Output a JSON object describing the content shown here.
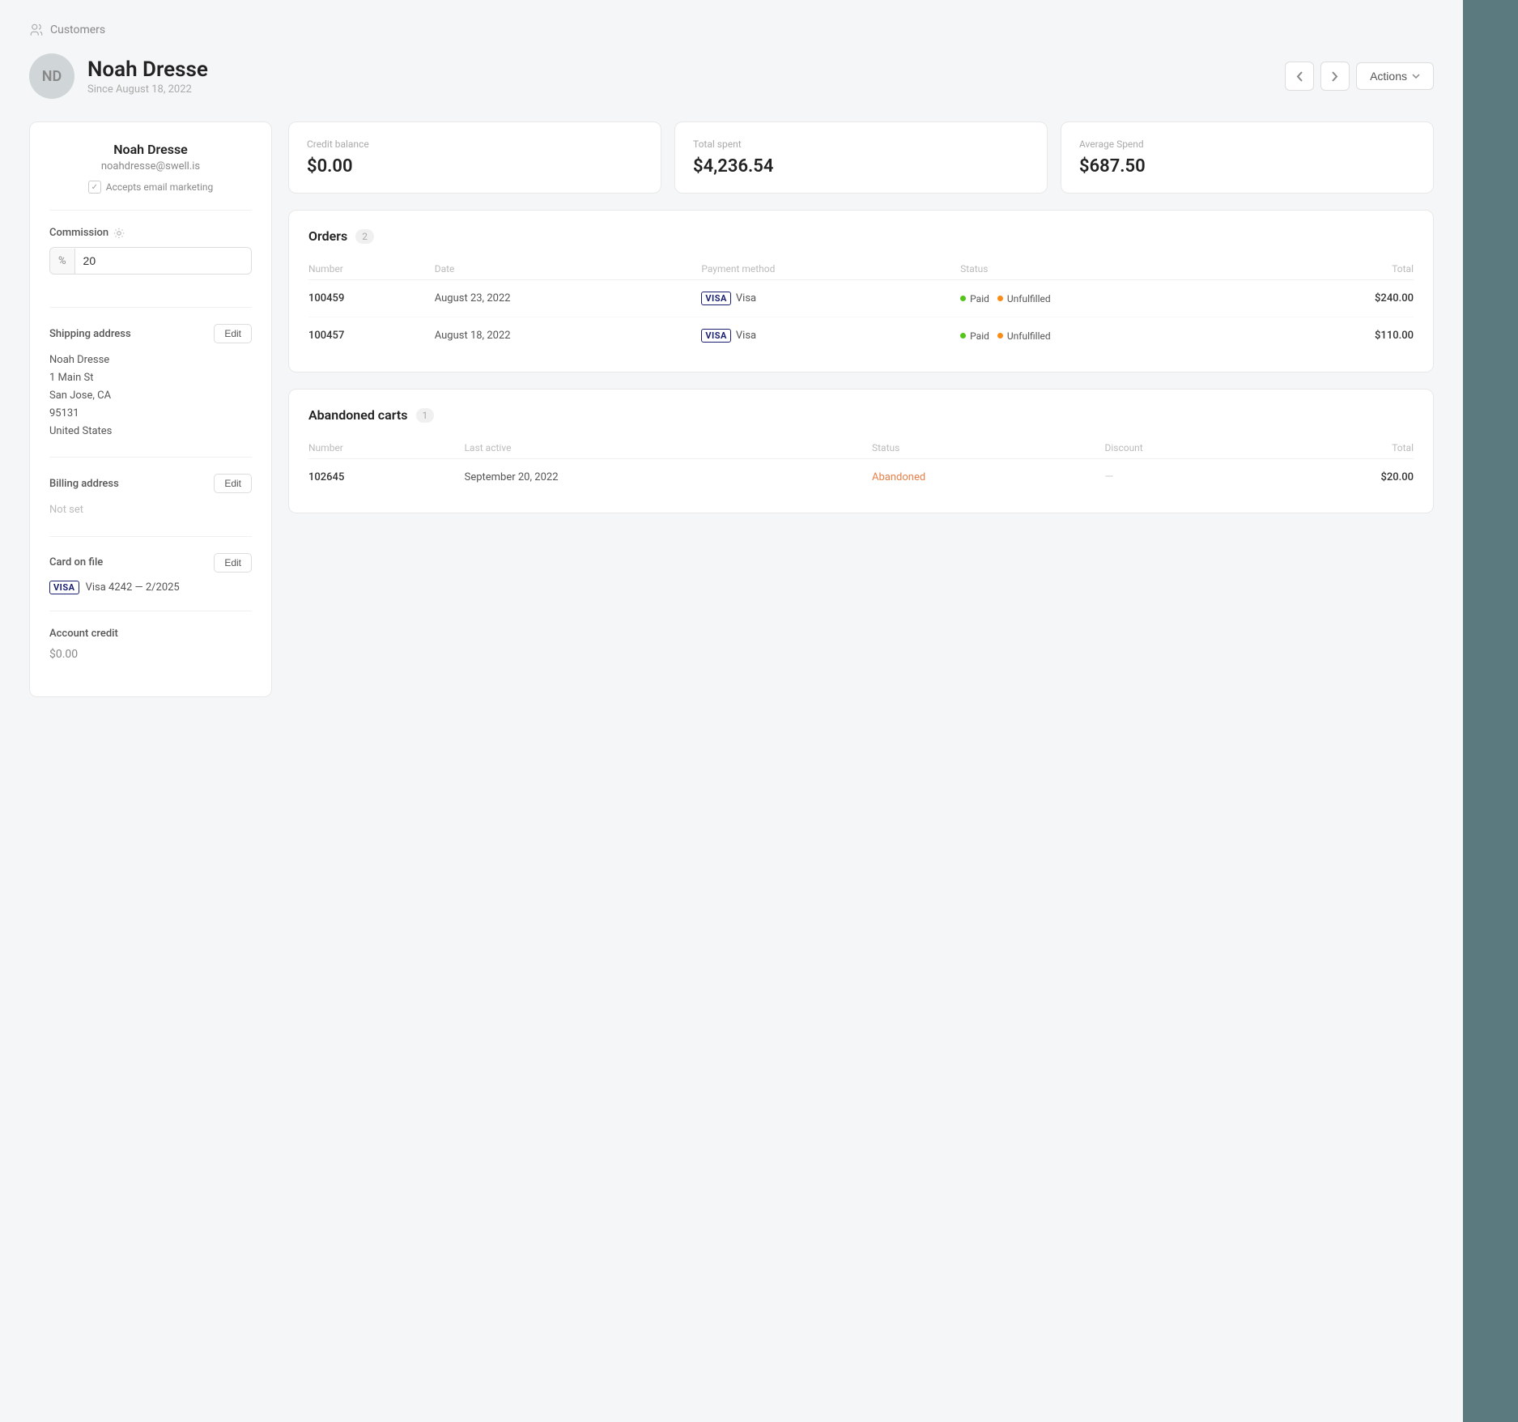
{
  "breadcrumb": {
    "label": "Customers",
    "icon": "customers-icon"
  },
  "header": {
    "avatar_initials": "ND",
    "customer_name": "Noah Dresse",
    "since_label": "Since August 18, 2022",
    "prev_label": "‹",
    "next_label": "›",
    "actions_label": "Actions"
  },
  "customer_panel": {
    "name": "Noah Dresse",
    "email": "noahdresse@swell.is",
    "email_marketing_label": "Accepts email marketing",
    "commission": {
      "label": "Commission",
      "prefix": "%",
      "value": "20"
    },
    "shipping_address": {
      "label": "Shipping address",
      "edit_label": "Edit",
      "lines": [
        "Noah Dresse",
        "1 Main St",
        "San Jose, CA",
        "95131",
        "United States"
      ]
    },
    "billing_address": {
      "label": "Billing address",
      "edit_label": "Edit",
      "value": "Not set"
    },
    "card_on_file": {
      "label": "Card on file",
      "edit_label": "Edit",
      "card_brand": "VISA",
      "card_info": "Visa 4242 — 2/2025"
    },
    "account_credit": {
      "label": "Account credit",
      "value": "$0.00"
    }
  },
  "stats": [
    {
      "label": "Credit balance",
      "value": "$0.00"
    },
    {
      "label": "Total spent",
      "value": "$4,236.54"
    },
    {
      "label": "Average Spend",
      "value": "$687.50"
    }
  ],
  "orders": {
    "title": "Orders",
    "count": "2",
    "columns": [
      "Number",
      "Date",
      "Payment method",
      "Status",
      "Total"
    ],
    "rows": [
      {
        "number": "100459",
        "date": "August 23, 2022",
        "payment_brand": "VISA",
        "payment_label": "Visa",
        "status_paid": "Paid",
        "status_fulfillment": "Unfulfilled",
        "total": "$240.00"
      },
      {
        "number": "100457",
        "date": "August 18, 2022",
        "payment_brand": "VISA",
        "payment_label": "Visa",
        "status_paid": "Paid",
        "status_fulfillment": "Unfulfilled",
        "total": "$110.00"
      }
    ]
  },
  "abandoned_carts": {
    "title": "Abandoned carts",
    "count": "1",
    "columns": [
      "Number",
      "Last active",
      "Status",
      "Discount",
      "Total"
    ],
    "rows": [
      {
        "number": "102645",
        "last_active": "September 20, 2022",
        "status": "Abandoned",
        "discount": "—",
        "total": "$20.00"
      }
    ]
  }
}
